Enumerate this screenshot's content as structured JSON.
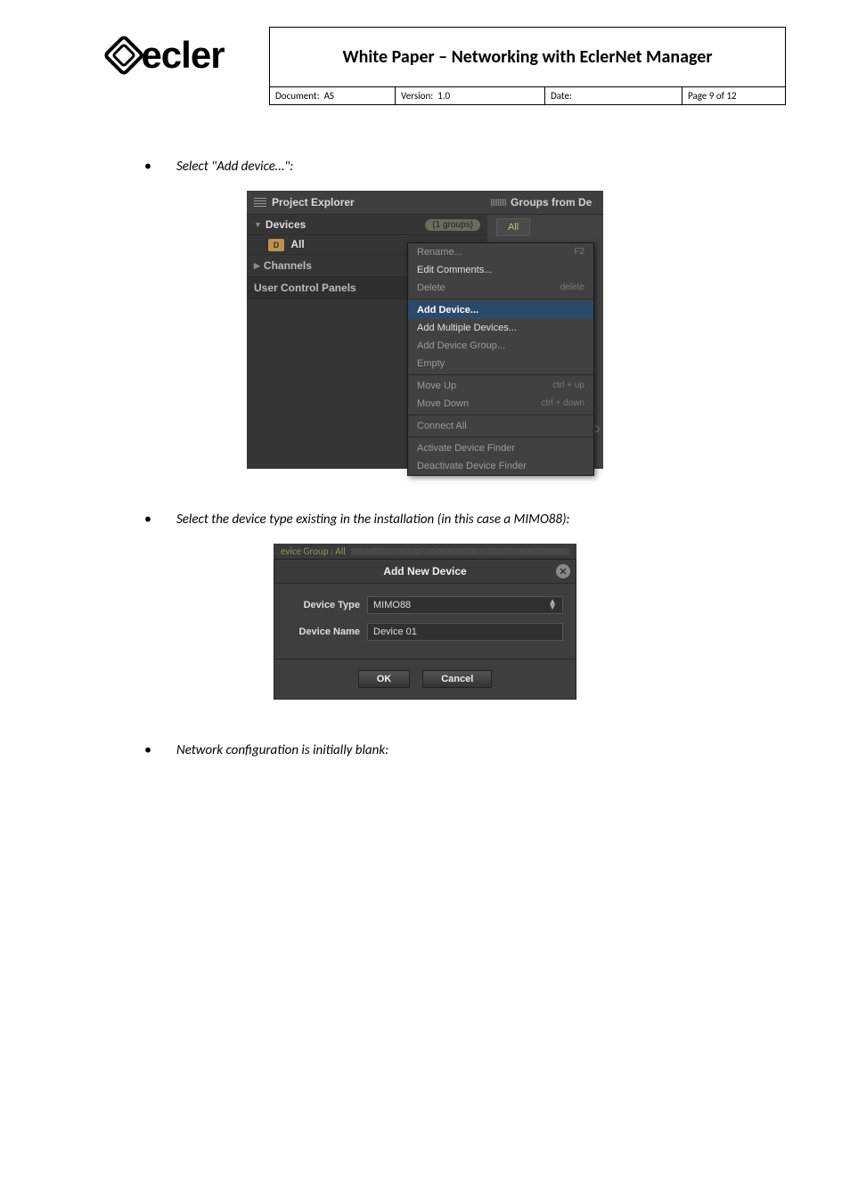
{
  "header": {
    "title": "White Paper – Networking with EclerNet Manager",
    "document_label": "Document:",
    "document_value": "AS",
    "version_label": "Version:",
    "version_value": "1.0",
    "date_label": "Date:",
    "date_value": "",
    "page_label": "Page 9 of 12",
    "logo_text": "ecler"
  },
  "bullets": {
    "b1": "Select \"Add device…\":",
    "b2": "Select the device type existing in the installation (in this case a MIMO88):",
    "b3": "Network configuration is initially blank:"
  },
  "project_explorer": {
    "title": "Project Explorer",
    "devices": "Devices",
    "groups_badge": "(1 groups)",
    "all": "All",
    "channels": "Channels",
    "ucp": "User Control Panels",
    "groups_from": "Groups from De",
    "all_tab": "All",
    "bottom_text": "om D"
  },
  "context_menu": {
    "rename": "Rename...",
    "rename_sc": "F2",
    "edit_comments": "Edit Comments...",
    "delete": "Delete",
    "delete_sc": "delete",
    "add_device": "Add Device...",
    "add_multiple": "Add Multiple Devices...",
    "add_group": "Add Device Group...",
    "empty": "Empty",
    "move_up": "Move Up",
    "move_up_sc": "ctrl + up",
    "move_down": "Move Down",
    "move_down_sc": "ctrl + down",
    "connect_all": "Connect All",
    "activate_finder": "Activate Device Finder",
    "deactivate_finder": "Deactivate Device Finder"
  },
  "dialog": {
    "top_breadcrumb": "evice Group : All",
    "title": "Add New Device",
    "type_label": "Device Type",
    "type_value": "MIMO88",
    "name_label": "Device Name",
    "name_value": "Device 01",
    "ok": "OK",
    "cancel": "Cancel"
  }
}
